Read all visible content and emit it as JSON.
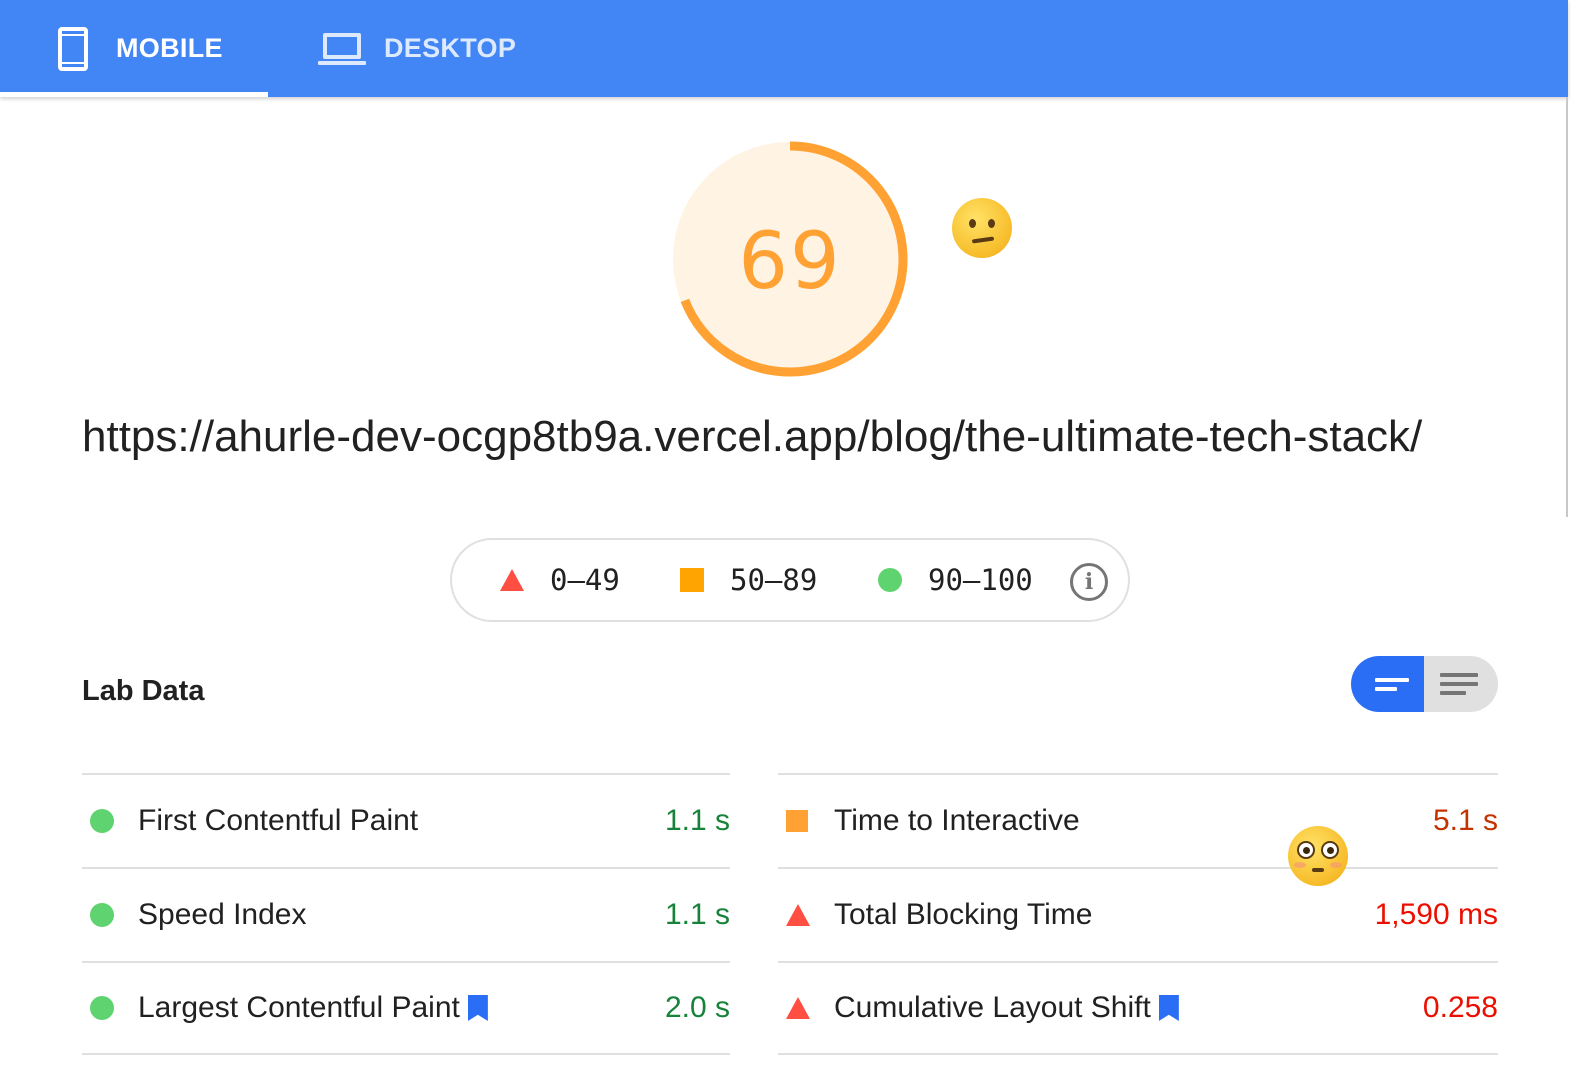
{
  "tabs": {
    "mobile_label": "MOBILE",
    "desktop_label": "DESKTOP",
    "active": "MOBILE"
  },
  "score": {
    "value": "69",
    "fraction": 0.69,
    "color": "#ffa133",
    "background": "#fff3e3"
  },
  "url": "https://ahurle-dev-ocgp8tb9a.vercel.app/blog/the-ultimate-tech-stack/",
  "legend": {
    "fail_range": "0–49",
    "average_range": "50–89",
    "pass_range": "90–100",
    "info_glyph": "i"
  },
  "lab_data": {
    "title": "Lab Data",
    "left_metrics": [
      {
        "label": "First Contentful Paint",
        "value": "1.1 s",
        "rating": "pass",
        "bookmark": false
      },
      {
        "label": "Speed Index",
        "value": "1.1 s",
        "rating": "pass",
        "bookmark": false
      },
      {
        "label": "Largest Contentful Paint",
        "value": "2.0 s",
        "rating": "pass",
        "bookmark": true
      }
    ],
    "right_metrics": [
      {
        "label": "Time to Interactive",
        "value": "5.1 s",
        "rating": "average",
        "bookmark": false
      },
      {
        "label": "Total Blocking Time",
        "value": "1,590 ms",
        "rating": "fail",
        "bookmark": false
      },
      {
        "label": "Cumulative Layout Shift",
        "value": "0.258",
        "rating": "fail",
        "bookmark": true
      }
    ]
  },
  "colors": {
    "tab_bar": "#4285f4",
    "pass": "#5ed36f",
    "average": "#ffa400",
    "fail": "#ff4e42",
    "toggle_active": "#2b6ef6"
  },
  "icons": {
    "mobile_tab": "phone-icon",
    "desktop_tab": "laptop-icon",
    "score_emoji": "confused-face-emoji",
    "metric_emoji": "flushed-face-emoji",
    "legend_info": "info-icon",
    "metric_bookmark": "bookmark-icon"
  }
}
